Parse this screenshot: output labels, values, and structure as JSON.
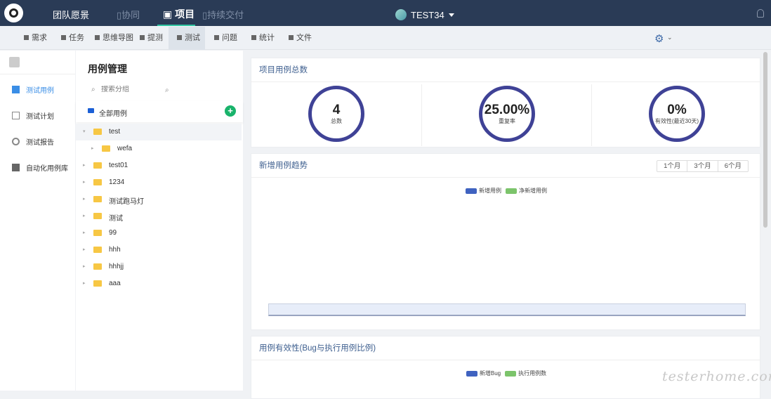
{
  "topnav": {
    "items": [
      "团队愿景",
      "协同",
      "项目",
      "持续交付"
    ],
    "project": "TEST34"
  },
  "subnav": {
    "items": [
      "需求",
      "任务",
      "思维导图",
      "提测",
      "测试",
      "问题",
      "统计",
      "文件"
    ]
  },
  "sidebar": {
    "items": [
      "测试用例",
      "测试计划",
      "测试报告",
      "自动化用例库"
    ]
  },
  "tree": {
    "title": "用例管理",
    "search_placeholder": "搜索分组",
    "all_label": "全部用例",
    "add": "+",
    "nodes": [
      "test",
      "wefa",
      "test01",
      "1234",
      "测试跑马灯",
      "测试",
      "99",
      "hhh",
      "hhhjj",
      "aaa"
    ]
  },
  "summary": {
    "title": "项目用例总数",
    "stats": [
      {
        "value": "4",
        "label": "总数"
      },
      {
        "value": "25.00%",
        "label": "重复率"
      },
      {
        "value": "0%",
        "label": "有效性(最近30天)"
      }
    ]
  },
  "trend": {
    "title": "新增用例趋势",
    "ranges": [
      "1个月",
      "3个月",
      "6个月"
    ],
    "legend": [
      "新增用例",
      "净新增用例"
    ]
  },
  "effect": {
    "title": "用例有效性(Bug与执行用例比例)",
    "legend": [
      "新增Bug",
      "执行用例数"
    ]
  },
  "colors": {
    "navy": "#2a3b56",
    "ring": "#3f4296",
    "blue": "#3f62c0",
    "green": "#7cc46b",
    "add": "#19b36b"
  },
  "watermark": "testerhome.com"
}
